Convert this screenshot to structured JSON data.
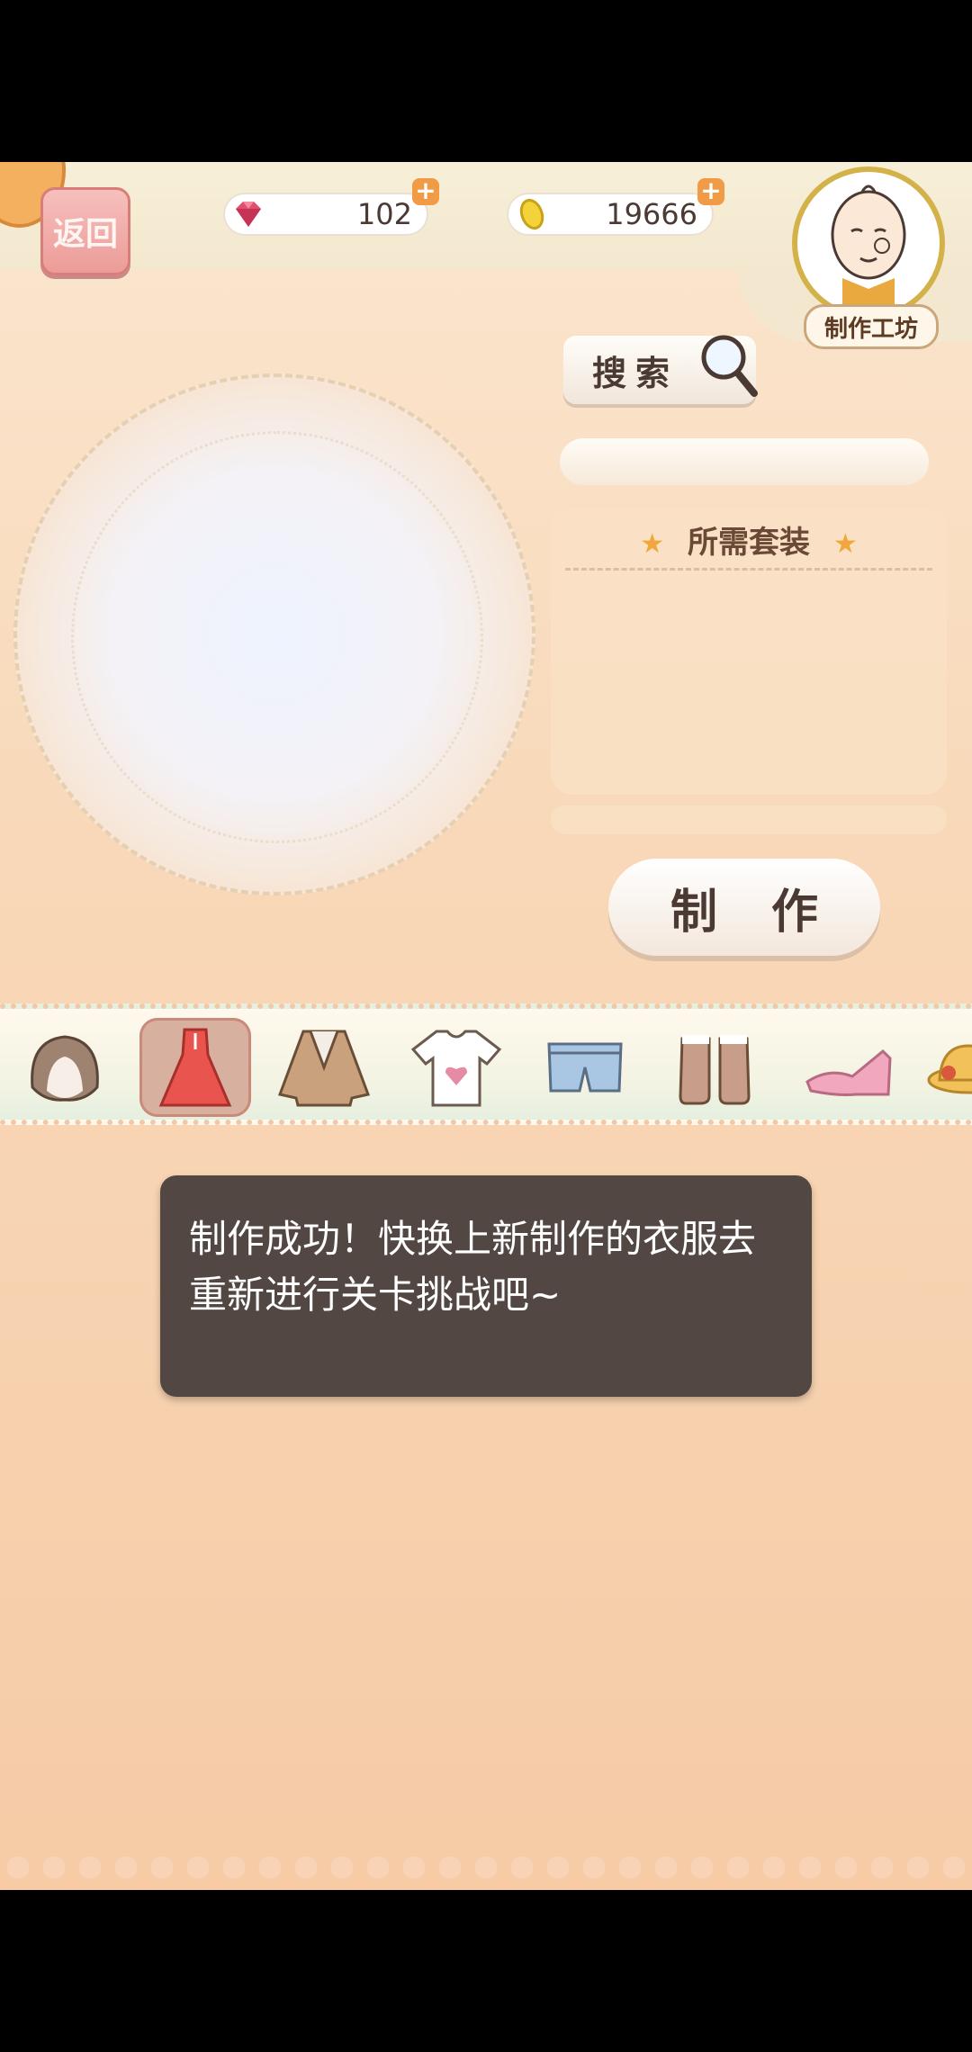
{
  "header": {
    "back_label": "返回",
    "gems": "102",
    "coins": "19666",
    "plus": "+",
    "workshop_label": "制作工坊"
  },
  "panel": {
    "search_label": "搜索",
    "required_title": "所需套装",
    "make_label": "制作"
  },
  "categories": [
    {
      "icon": "hair-icon"
    },
    {
      "icon": "dress-icon",
      "selected": true
    },
    {
      "icon": "jacket-icon"
    },
    {
      "icon": "tshirt-icon"
    },
    {
      "icon": "shorts-icon"
    },
    {
      "icon": "socks-icon"
    },
    {
      "icon": "heels-icon"
    },
    {
      "icon": "hat-icon"
    }
  ],
  "toast": {
    "message": "制作成功！快换上新制作的衣服去重新进行关卡挑战吧~"
  },
  "colors": {
    "accent": "#f29b47",
    "toast_bg": "#524743",
    "back_button": "#ec9c98"
  }
}
